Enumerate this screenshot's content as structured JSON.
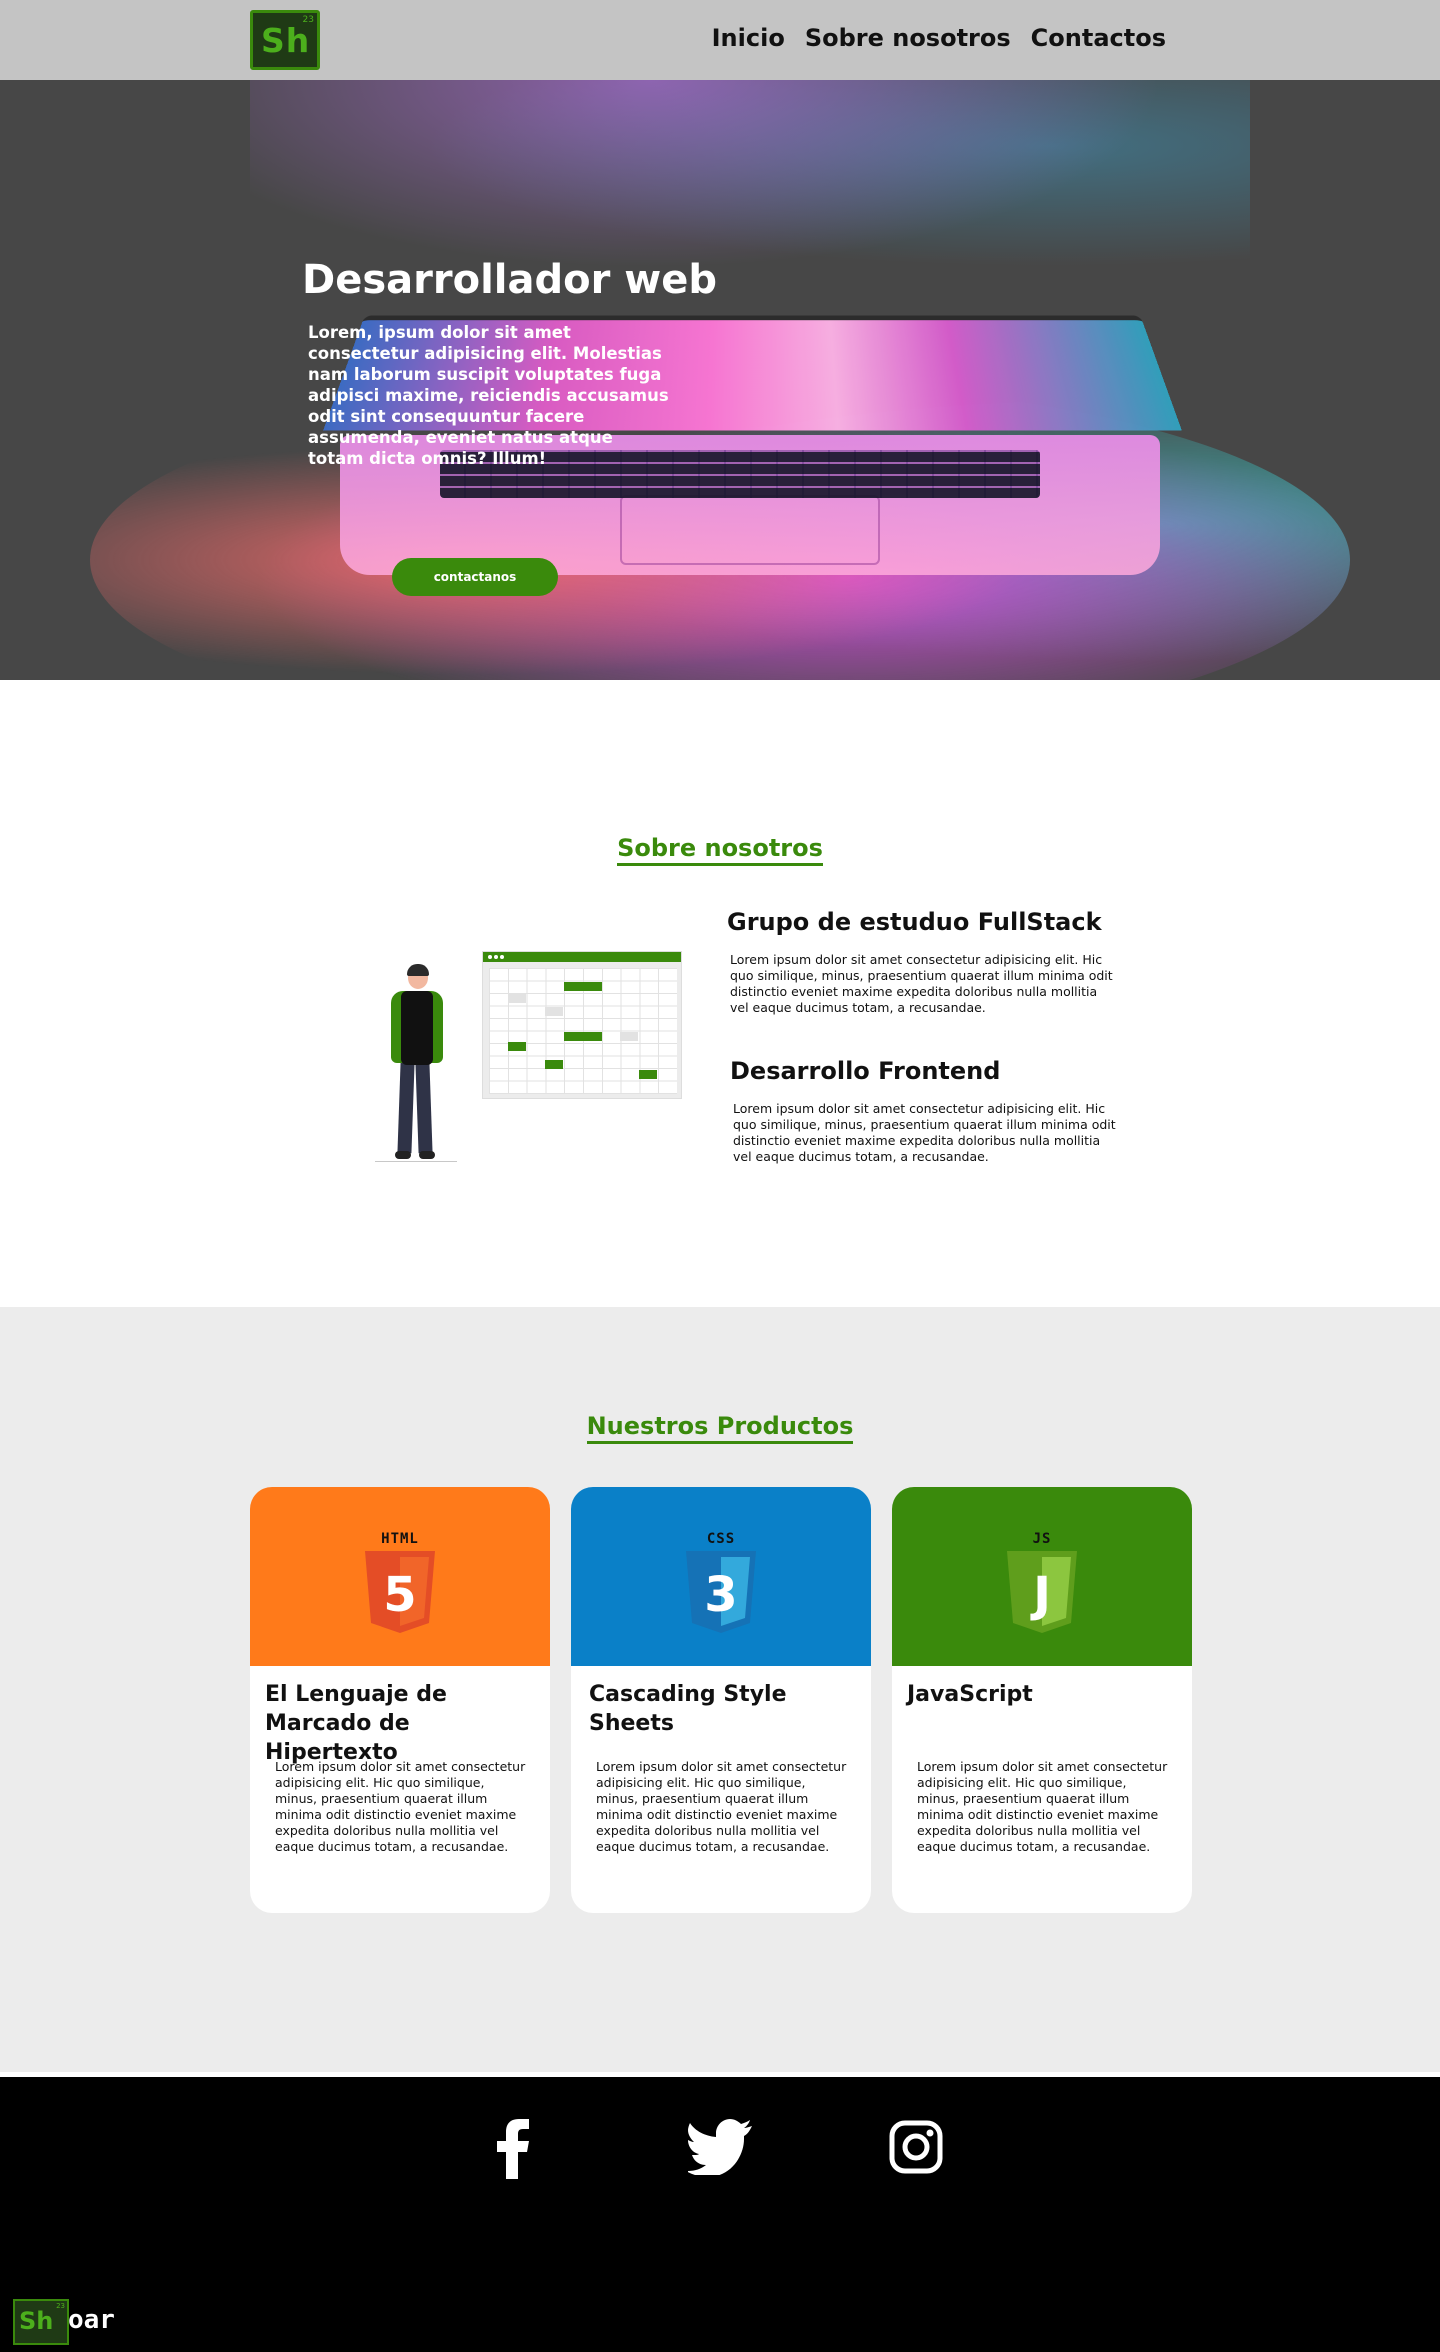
{
  "brand": {
    "logo_text": "Sh",
    "logo_number": "23",
    "footer_name": "oar"
  },
  "nav": {
    "items": [
      {
        "label": "Inicio"
      },
      {
        "label": "Sobre nosotros"
      },
      {
        "label": "Contactos"
      }
    ]
  },
  "hero": {
    "title": "Desarrollador web",
    "text": "Lorem, ipsum dolor sit amet consectetur adipisicing elit. Molestias nam laborum suscipit voluptates fuga adipisci maxime, reiciendis accusamus odit sint consequuntur facere assumenda, eveniet natus atque totam dicta omnis? Illum!",
    "button_label": "contactanos"
  },
  "about": {
    "title": "Sobre nosotros",
    "blocks": [
      {
        "heading": "Grupo de estuduo FullStack",
        "text": "Lorem ipsum dolor sit amet consectetur adipisicing elit. Hic quo similique, minus, praesentium quaerat illum minima odit distinctio eveniet maxime expedita doloribus nulla mollitia vel eaque ducimus totam, a recusandae."
      },
      {
        "heading": "Desarrollo Frontend",
        "text": "Lorem ipsum dolor sit amet consectetur adipisicing elit. Hic quo similique, minus, praesentium quaerat illum minima odit distinctio eveniet maxime expedita doloribus nulla mollitia vel eaque ducimus totam, a recusandae."
      }
    ]
  },
  "products": {
    "title": "Nuestros Productos",
    "cards": [
      {
        "badge": "HTML",
        "glyph": "5",
        "heading": "El Lenguaje de Marcado de Hipertexto",
        "text": "Lorem ipsum dolor sit amet consectetur adipisicing elit. Hic quo similique, minus, praesentium quaerat illum minima odit distinctio eveniet maxime expedita doloribus nulla mollitia vel eaque ducimus totam, a recusandae.",
        "color": "#ff7a1a",
        "shield_color": "#e44d26",
        "shield_light": "#f16529",
        "icon": "html5-icon"
      },
      {
        "badge": "CSS",
        "glyph": "3",
        "heading": "Cascading Style Sheets",
        "text": "Lorem ipsum dolor sit amet consectetur adipisicing elit. Hic quo similique, minus, praesentium quaerat illum minima odit distinctio eveniet maxime expedita doloribus nulla mollitia vel eaque ducimus totam, a recusandae.",
        "color": "#0a80c8",
        "shield_color": "#1572b6",
        "shield_light": "#33a9dc",
        "icon": "css3-icon"
      },
      {
        "badge": "JS",
        "glyph": "J",
        "heading": "JavaScript",
        "text": "Lorem ipsum dolor sit amet consectetur adipisicing elit. Hic quo similique, minus, praesentium quaerat illum minima odit distinctio eveniet maxime expedita doloribus nulla mollitia vel eaque ducimus totam, a recusandae.",
        "color": "#3a8a0c",
        "shield_color": "#5f9e1c",
        "shield_light": "#8cc63f",
        "icon": "js-icon"
      }
    ]
  },
  "footer": {
    "social": [
      {
        "icon": "facebook-icon"
      },
      {
        "icon": "twitter-icon"
      },
      {
        "icon": "instagram-icon"
      }
    ]
  },
  "colors": {
    "accent": "#3a8a0c",
    "nav_bg": "#c4c4c4",
    "products_bg": "#ececec",
    "footer_bg": "#000000"
  }
}
